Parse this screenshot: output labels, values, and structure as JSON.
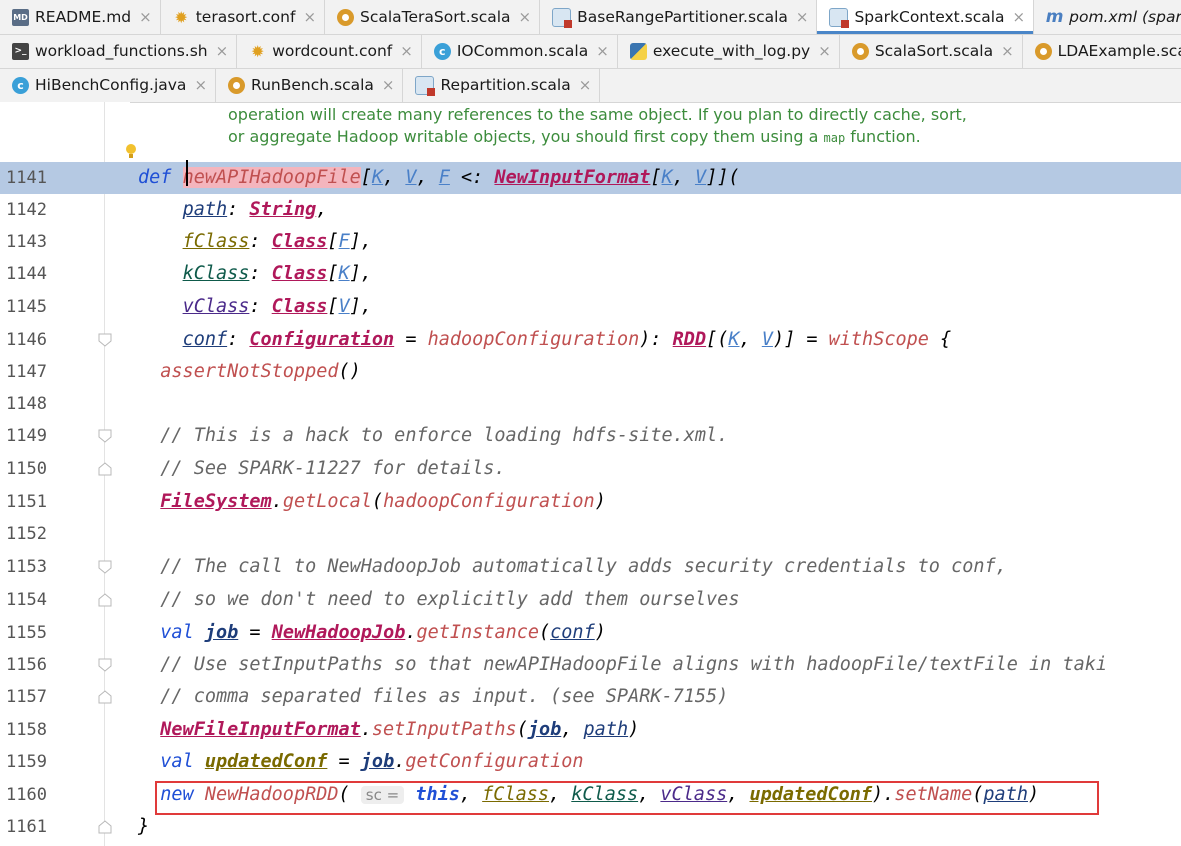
{
  "tabs": {
    "row1": [
      {
        "label": "README.md",
        "icon": "markdown-file-icon",
        "active": false
      },
      {
        "label": "terasort.conf",
        "icon": "config-file-icon",
        "active": false
      },
      {
        "label": "ScalaTeraSort.scala",
        "icon": "scala-object-icon",
        "active": false
      },
      {
        "label": "BaseRangePartitioner.scala",
        "icon": "scala-class-icon",
        "active": false
      },
      {
        "label": "SparkContext.scala",
        "icon": "scala-readonly-class-icon",
        "active": true
      },
      {
        "label": "pom.xml (sparkbench)",
        "icon": "maven-file-icon",
        "active": false,
        "italic": true
      }
    ],
    "row2": [
      {
        "label": "workload_functions.sh",
        "icon": "shell-script-icon",
        "active": false
      },
      {
        "label": "wordcount.conf",
        "icon": "config-file-icon",
        "active": false
      },
      {
        "label": "IOCommon.scala",
        "icon": "scala-class-icon",
        "active": false
      },
      {
        "label": "execute_with_log.py",
        "icon": "python-file-icon",
        "active": false
      },
      {
        "label": "ScalaSort.scala",
        "icon": "scala-object-icon",
        "active": false
      },
      {
        "label": "LDAExample.scala",
        "icon": "scala-object-icon",
        "active": false
      }
    ],
    "row3": [
      {
        "label": "HiBenchConfig.java",
        "icon": "java-class-icon",
        "active": false
      },
      {
        "label": "RunBench.scala",
        "icon": "scala-object-icon",
        "active": false
      },
      {
        "label": "Repartition.scala",
        "icon": "scala-readonly-class-icon",
        "active": false
      }
    ],
    "close_glyph": "×"
  },
  "doc_comment": {
    "line1": "operation will create many references to the same object. If you plan to directly cache, sort,",
    "line2_prefix": "or aggregate Hadoop writable objects, you should first copy them using a ",
    "line2_code": "map",
    "line2_suffix": " function."
  },
  "code": {
    "highlighted_line": "1141",
    "lines": [
      {
        "n": "1141"
      },
      {
        "n": "1142"
      },
      {
        "n": "1143"
      },
      {
        "n": "1144"
      },
      {
        "n": "1145"
      },
      {
        "n": "1146"
      },
      {
        "n": "1147"
      },
      {
        "n": "1148"
      },
      {
        "n": "1149"
      },
      {
        "n": "1150"
      },
      {
        "n": "1151"
      },
      {
        "n": "1152"
      },
      {
        "n": "1153"
      },
      {
        "n": "1154"
      },
      {
        "n": "1155"
      },
      {
        "n": "1156"
      },
      {
        "n": "1157"
      },
      {
        "n": "1158"
      },
      {
        "n": "1159"
      },
      {
        "n": "1160"
      },
      {
        "n": "1161"
      }
    ],
    "t": {
      "def": "def",
      "name": "newAPIHadoopFile",
      "K": "K",
      "V": "V",
      "F": "F",
      "bound": "<:",
      "NewInputFormat": "NewInputFormat",
      "path": "path",
      "String": "String",
      "fClass": "fClass",
      "kClass": "kClass",
      "vClass": "vClass",
      "Class": "Class",
      "conf": "conf",
      "Configuration": "Configuration",
      "hadoopConfiguration": "hadoopConfiguration",
      "RDD": "RDD",
      "withScope": "withScope",
      "assertNotStopped": "assertNotStopped",
      "c1149": "// This is a hack to enforce loading hdfs-site.xml.",
      "c1150": "// See SPARK-11227 for details.",
      "FileSystem": "FileSystem",
      "getLocal": "getLocal",
      "c1153": "// The call to NewHadoopJob automatically adds security credentials to conf,",
      "c1154": "// so we don't need to explicitly add them ourselves",
      "val": "val",
      "job": "job",
      "NewHadoopJob": "NewHadoopJob",
      "getInstance": "getInstance",
      "c1156": "// Use setInputPaths so that newAPIHadoopFile aligns with hadoopFile/textFile in taki",
      "c1157": "// comma separated files as input. (see SPARK-7155)",
      "NewFileInputFormat": "NewFileInputFormat",
      "setInputPaths": "setInputPaths",
      "updatedConf": "updatedConf",
      "getConfiguration": "getConfiguration",
      "new": "new",
      "NewHadoopRDD": "NewHadoopRDD",
      "hint_sc": "sc =",
      "this": "this",
      "setName": "setName",
      "close": "}"
    }
  },
  "colors": {
    "highlight_line": "#b5c9e3",
    "selection_box": "#e03a3a",
    "active_tab_underline": "#4a86c8"
  }
}
